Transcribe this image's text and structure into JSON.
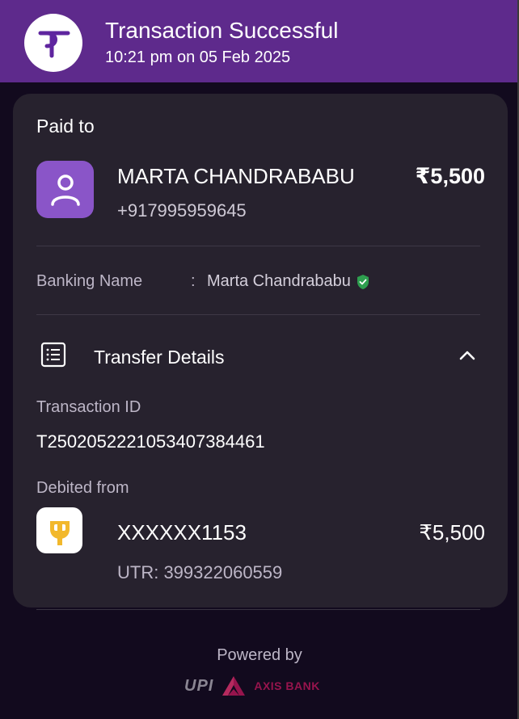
{
  "header": {
    "title": "Transaction Successful",
    "datetime": "10:21 pm on 05 Feb 2025",
    "logo_icon": "phonepe-logo-icon"
  },
  "paid_to": {
    "label": "Paid to",
    "name": "MARTA CHANDRABABU",
    "phone": "+917995959645",
    "amount": "₹5,500",
    "avatar_icon": "user-avatar-icon"
  },
  "banking": {
    "label": "Banking Name",
    "colon": ":",
    "value": "Marta Chandrababu",
    "verified_icon": "verified-shield-icon"
  },
  "transfer_details": {
    "title": "Transfer Details",
    "transaction_id_label": "Transaction ID",
    "transaction_id": "T2502052221053407384461",
    "debited_from_label": "Debited from",
    "account": "XXXXXX1153",
    "amount": "₹5,500",
    "utr": "UTR: 399322060559"
  },
  "footer": {
    "powered_by": "Powered by",
    "upi_logo": "UPI",
    "bank_logo": "AXIS BANK"
  },
  "colors": {
    "header_bg": "#5e2a8c",
    "card_bg": "#27222e",
    "page_bg": "#120a1e",
    "avatar_bg": "#8a55c8",
    "verified": "#2e9e4f",
    "axis_brand": "#97144d",
    "pnb_brand": "#f2b82c"
  }
}
